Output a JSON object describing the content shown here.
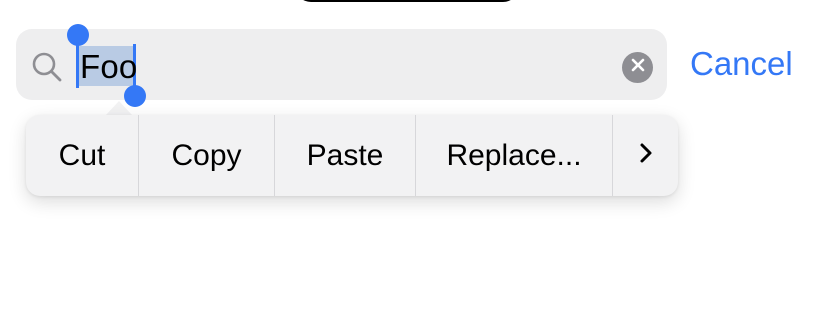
{
  "search": {
    "query": "Foo",
    "search_icon": "search-icon",
    "clear_icon": "clear-icon",
    "cancel_label": "Cancel"
  },
  "edit_menu": {
    "items": [
      {
        "label": "Cut"
      },
      {
        "label": "Copy"
      },
      {
        "label": "Paste"
      },
      {
        "label": "Replace..."
      }
    ],
    "more_icon": "chevron-right-icon"
  },
  "colors": {
    "accent": "#3478f6",
    "selection": "#b9cbe4",
    "search_field": "#eeeeef",
    "menu": "#f2f2f3",
    "clear_button": "#8e8e93"
  }
}
